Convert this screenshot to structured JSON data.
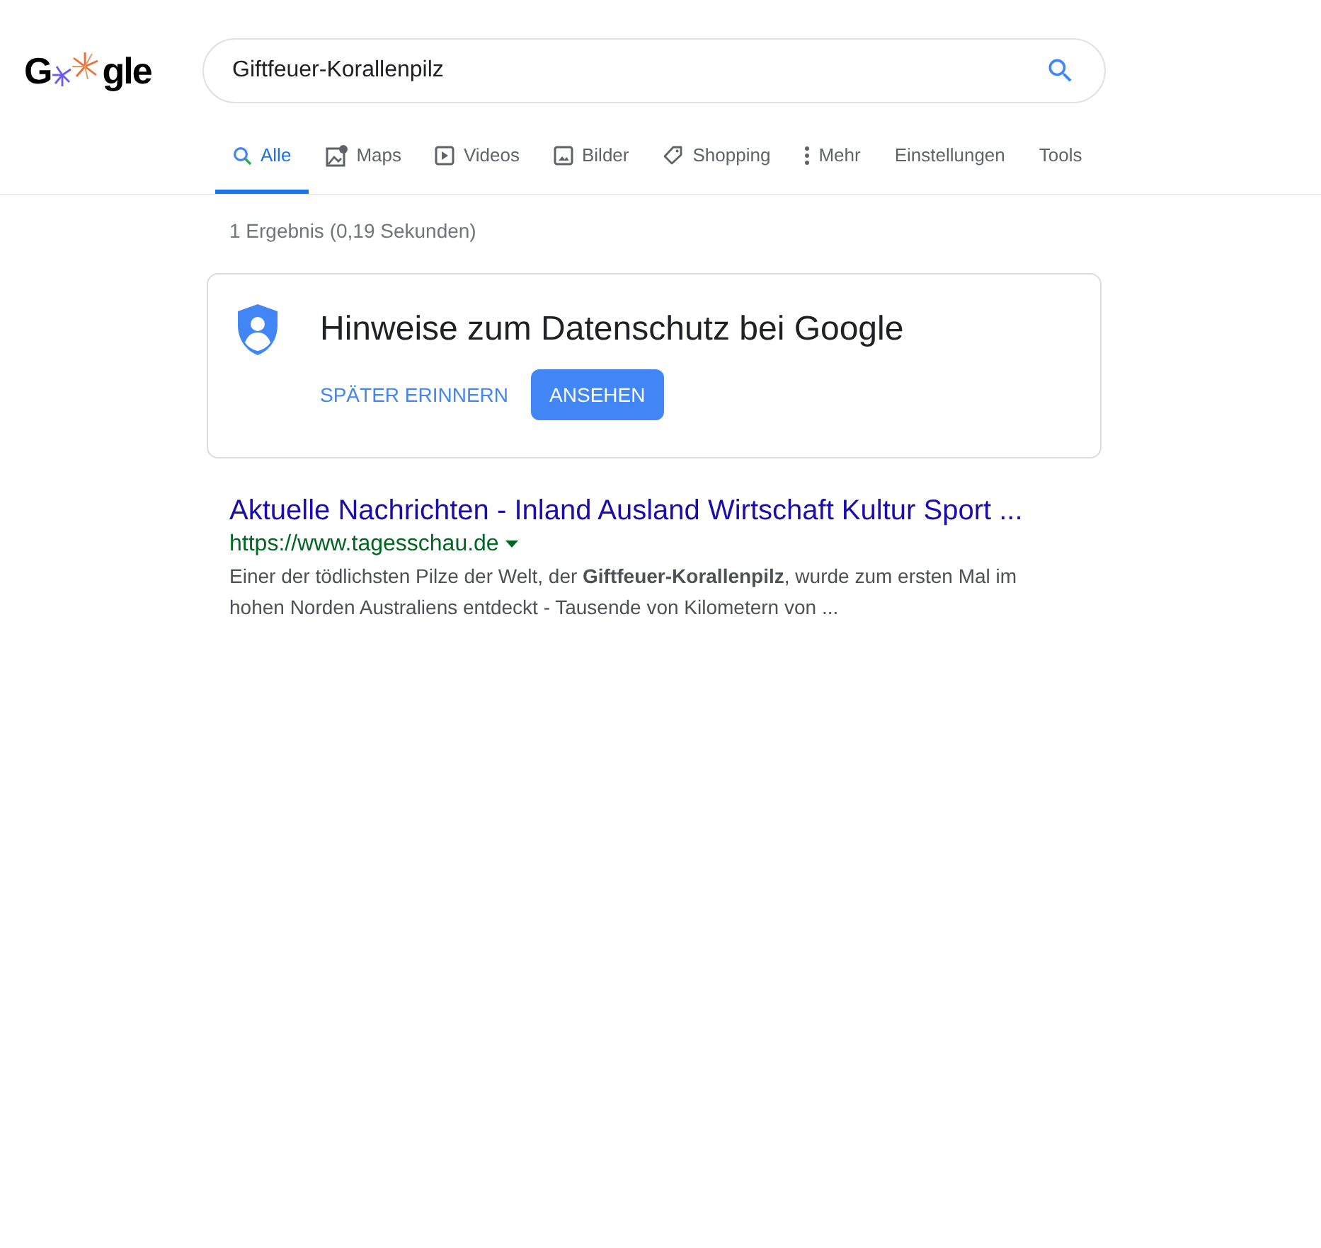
{
  "logo": {
    "left": "G",
    "right": "gle"
  },
  "search": {
    "value": "Giftfeuer-Korallenpilz"
  },
  "tabs": [
    {
      "label": "Alle",
      "kind": "search",
      "selected": true
    },
    {
      "label": "Maps",
      "kind": "maps",
      "selected": false
    },
    {
      "label": "Videos",
      "kind": "video",
      "selected": false
    },
    {
      "label": "Bilder",
      "kind": "image",
      "selected": false
    },
    {
      "label": "Shopping",
      "kind": "tag",
      "selected": false
    },
    {
      "label": "Mehr",
      "kind": "more",
      "selected": false
    },
    {
      "label": "Einstellungen",
      "kind": "plain",
      "selected": false
    },
    {
      "label": "Tools",
      "kind": "plain",
      "selected": false
    }
  ],
  "result_stats": "1 Ergebnis (0,19 Sekunden)",
  "privacy_card": {
    "title": "Hinweise zum Datenschutz bei Google",
    "later_button": "SPÄTER ERINNERN",
    "view_button": "ANSEHEN"
  },
  "results": [
    {
      "title": "Aktuelle Nachrichten - Inland Ausland Wirtschaft Kultur Sport ...",
      "url": "https://www.tagesschau.de",
      "snippet": "Einer der tödlichsten Pilze der Welt, der **Giftfeuer-Korallenpilz**, wurde zum ersten Mal im hohen Norden Australiens entdeckt - Tausende von Kilometern von ..."
    }
  ]
}
